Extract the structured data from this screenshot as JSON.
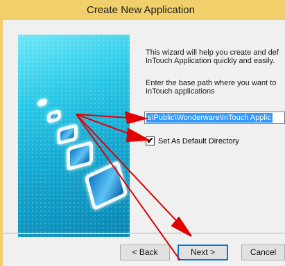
{
  "window": {
    "title": "Create New Application"
  },
  "intro": {
    "line1": "This wizard will help you create and def",
    "line2": "InTouch Application quickly and easily."
  },
  "base_path": {
    "line1": "Enter the base path where you want to",
    "line2": "InTouch applications",
    "value": "s\\Public\\Wonderware\\InTouch Applic"
  },
  "default_dir": {
    "label": "Set As Default Directory",
    "checked": true
  },
  "buttons": {
    "back": "< Back",
    "next": "Next >",
    "cancel": "Cancel"
  },
  "colors": {
    "title_bar": "#f1d06b",
    "selection": "#3399ff",
    "annotation": "#e00000"
  }
}
